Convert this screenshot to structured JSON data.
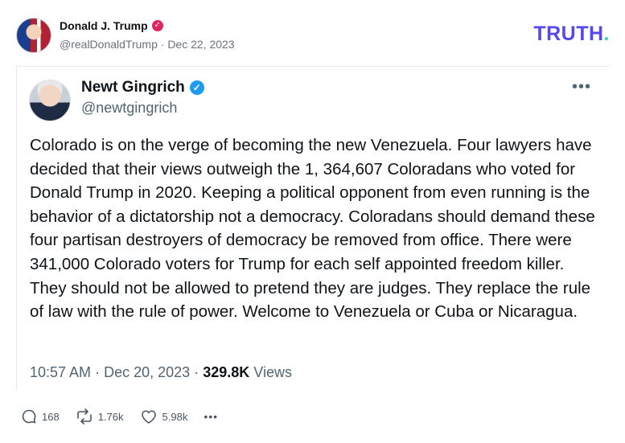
{
  "post": {
    "author_name": "Donald J. Trump",
    "author_handle": "@realDonaldTrump",
    "separator": "·",
    "date": "Dec 22, 2023",
    "brand": "TRUTH",
    "brand_dot": "."
  },
  "quoted_tweet": {
    "name": "Newt Gingrich",
    "handle": "@newtgingrich",
    "text": "Colorado is on the verge of becoming the new Venezuela. Four lawyers have decided that their views outweigh the 1, 364,607 Coloradans who voted for Donald Trump in 2020. Keeping a political opponent from even running is the behavior of a dictatorship not a democracy. Coloradans should demand these four partisan destroyers of democracy be removed from office. There were 341,000 Colorado voters for Trump for each self appointed freedom killer. They should not be allowed to pretend they are judges. They replace the rule of law with the rule of power. Welcome to Venezuela or Cuba or Nicaragua.",
    "time": "10:57 AM",
    "separator": "·",
    "date": "Dec 20, 2023",
    "views_count": "329.8K",
    "views_label": "Views"
  },
  "actions": {
    "replies": "168",
    "retruths": "1.76k",
    "likes": "5.98k",
    "more": "•••"
  },
  "icons": {
    "verified_red": "verified-badge-red",
    "verified_blue": "verified-badge-blue",
    "reply": "speech-bubble-icon",
    "retruth": "repost-arrows-icon",
    "like": "heart-icon",
    "more": "ellipsis-icon"
  },
  "colors": {
    "brand": "#5448ee",
    "brand_dot": "#2fd2b5",
    "verified_red": "#e0245e",
    "verified_blue": "#1d9bf0"
  }
}
